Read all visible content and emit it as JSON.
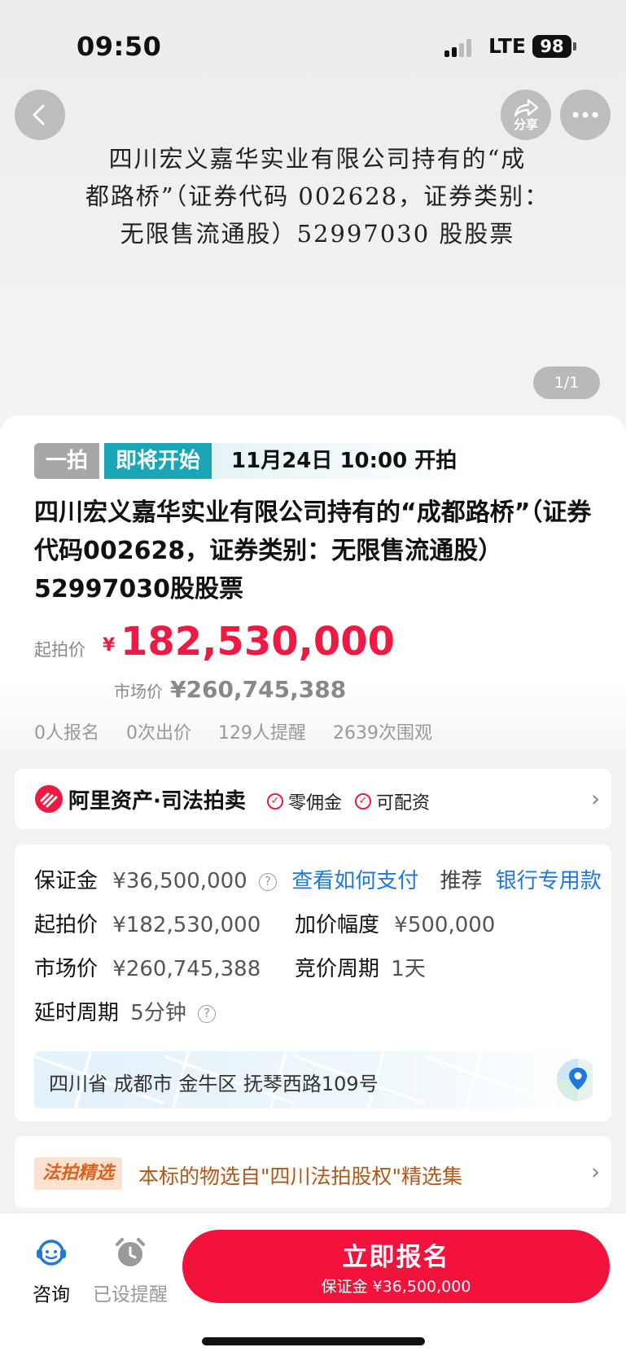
{
  "status_bar": {
    "time": "09:50",
    "network": "LTE",
    "battery": "98"
  },
  "hero": {
    "share_label": "分享",
    "document_lines": [
      "四川宏义嘉华实业有限公司持有的“成",
      "都路桥”（证券代码 002628，证券类别：",
      "无限售流通股）52997030 股股票"
    ],
    "page_indicator": "1/1"
  },
  "auction": {
    "round_tag": "一拍",
    "status_tag": "即将开始",
    "start_time": "11月24日 10:00 开拍",
    "title": "四川宏义嘉华实业有限公司持有的“成都路桥”（证券代码002628，证券类别：无限售流通股）52997030股股票",
    "start_price_label": "起拍价",
    "currency": "¥",
    "start_price": "182,530,000",
    "market_price_label": "市场价",
    "market_price": "¥260,745,388",
    "stats": [
      "0人报名",
      "0次出价",
      "129人提醒",
      "2639次围观"
    ]
  },
  "brand": {
    "name": "阿里资产·司法拍卖",
    "badges": [
      "零佣金",
      "可配资"
    ]
  },
  "details": {
    "deposit_label": "保证金",
    "deposit_value": "¥36,500,000",
    "how_to_pay": "查看如何支付",
    "recommend_label": "推荐",
    "recommend_link": "银行专用款",
    "start_price_label": "起拍价",
    "start_price_value": "¥182,530,000",
    "increment_label": "加价幅度",
    "increment_value": "¥500,000",
    "market_price_label": "市场价",
    "market_price_value": "¥260,745,388",
    "cycle_label": "竞价周期",
    "cycle_value": "1天",
    "delay_label": "延时周期",
    "delay_value": "5分钟",
    "address": "四川省 成都市 金牛区 抚琴西路109号"
  },
  "featured": {
    "badge": "法拍精选",
    "text": "本标的物选自\"四川法拍股权\"精选集"
  },
  "bottom_bar": {
    "consult_label": "咨询",
    "remind_label": "已设提醒",
    "cta_label": "立即报名",
    "cta_sub": "保证金 ¥36,500,000"
  },
  "colors": {
    "accent_red": "#f2123b",
    "status_teal": "#1aa6b7",
    "link_blue": "#1f78e0",
    "featured_orange": "#e0601d"
  }
}
